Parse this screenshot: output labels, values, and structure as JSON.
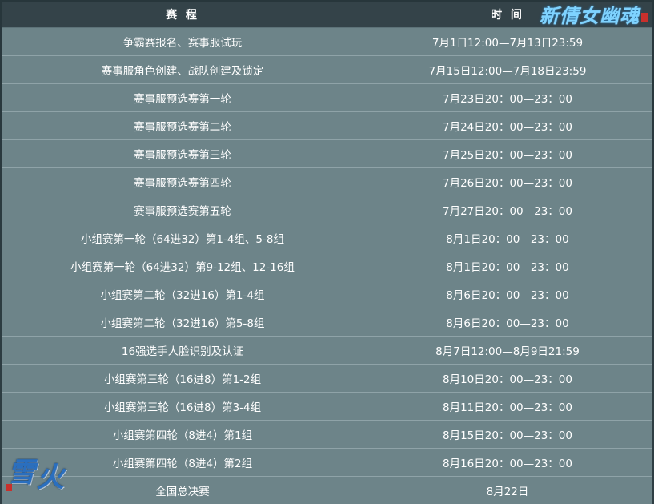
{
  "header": {
    "stage_label": "赛 程",
    "time_label": "时 间"
  },
  "logo_top": {
    "chars": [
      "新",
      "倩",
      "女",
      "幽",
      "魂"
    ]
  },
  "logo_bottom": {
    "chars": [
      "雪",
      "火"
    ]
  },
  "rows": [
    {
      "stage": "争霸赛报名、赛事服试玩",
      "time": "7月1日12:00—7月13日23:59"
    },
    {
      "stage": "赛事服角色创建、战队创建及锁定",
      "time": "7月15日12:00—7月18日23:59"
    },
    {
      "stage": "赛事服预选赛第一轮",
      "time": "7月23日20：00—23：00"
    },
    {
      "stage": "赛事服预选赛第二轮",
      "time": "7月24日20：00—23：00"
    },
    {
      "stage": "赛事服预选赛第三轮",
      "time": "7月25日20：00—23：00"
    },
    {
      "stage": "赛事服预选赛第四轮",
      "time": "7月26日20：00—23：00"
    },
    {
      "stage": "赛事服预选赛第五轮",
      "time": "7月27日20：00—23：00"
    },
    {
      "stage": "小组赛第一轮（64进32）第1-4组、5-8组",
      "time": "8月1日20：00—23：00"
    },
    {
      "stage": "小组赛第一轮（64进32）第9-12组、12-16组",
      "time": "8月1日20：00—23：00"
    },
    {
      "stage": "小组赛第二轮（32进16）第1-4组",
      "time": "8月6日20：00—23：00"
    },
    {
      "stage": "小组赛第二轮（32进16）第5-8组",
      "time": "8月6日20：00—23：00"
    },
    {
      "stage": "16强选手人脸识别及认证",
      "time": "8月7日12:00—8月9日21:59"
    },
    {
      "stage": "小组赛第三轮（16进8）第1-2组",
      "time": "8月10日20：00—23：00"
    },
    {
      "stage": "小组赛第三轮（16进8）第3-4组",
      "time": "8月11日20：00—23：00"
    },
    {
      "stage": "小组赛第四轮（8进4）第1组",
      "time": "8月15日20：00—23：00"
    },
    {
      "stage": "小组赛第四轮（8进4）第2组",
      "time": "8月16日20：00—23：00"
    },
    {
      "stage": "全国总决赛",
      "time": "8月22日"
    }
  ]
}
